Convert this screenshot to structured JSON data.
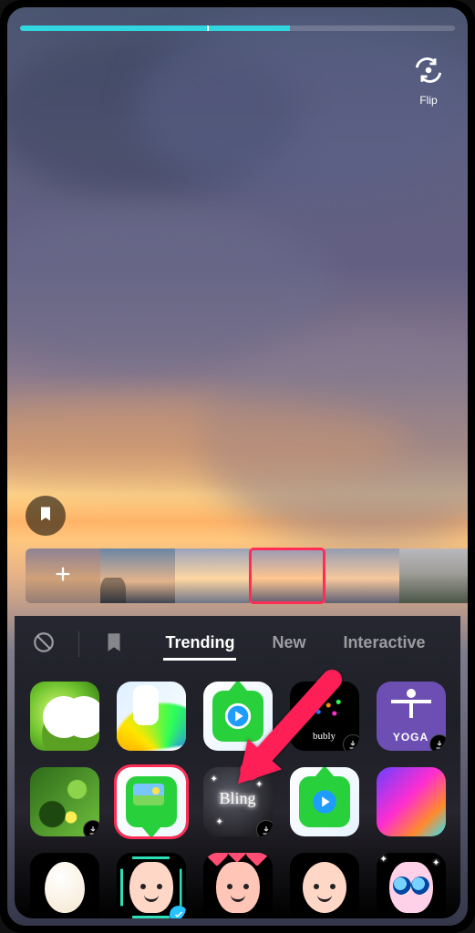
{
  "progress": {
    "percent": 62,
    "tick_percent": 43
  },
  "controls": {
    "flip_label": "Flip"
  },
  "clips": {
    "count": 5,
    "selected_index": 2
  },
  "tabs": {
    "items": [
      {
        "label": "Trending",
        "active": true
      },
      {
        "label": "New",
        "active": false
      },
      {
        "label": "Interactive",
        "active": false
      }
    ]
  },
  "effects": {
    "row1": [
      {
        "name": "dragon",
        "downloadable": false
      },
      {
        "name": "rainbow-hand",
        "downloadable": false
      },
      {
        "name": "green-screen-up",
        "downloadable": false
      },
      {
        "name": "bubly",
        "label": "bubly",
        "downloadable": true
      },
      {
        "name": "yoga",
        "label": "YOGA",
        "downloadable": true
      }
    ],
    "row2": [
      {
        "name": "jungle",
        "downloadable": true
      },
      {
        "name": "green-screen-down",
        "selected": true
      },
      {
        "name": "bling",
        "label": "Bling",
        "downloadable": true
      },
      {
        "name": "green-screen-up-2"
      },
      {
        "name": "gradient"
      }
    ],
    "row3": [
      {
        "name": "egg"
      },
      {
        "name": "face-scan",
        "checked": true
      },
      {
        "name": "hearts-face"
      },
      {
        "name": "mom-face"
      },
      {
        "name": "big-eyes"
      }
    ]
  },
  "colors": {
    "accent": "#ff2d55",
    "progress": "#30d6e0"
  }
}
